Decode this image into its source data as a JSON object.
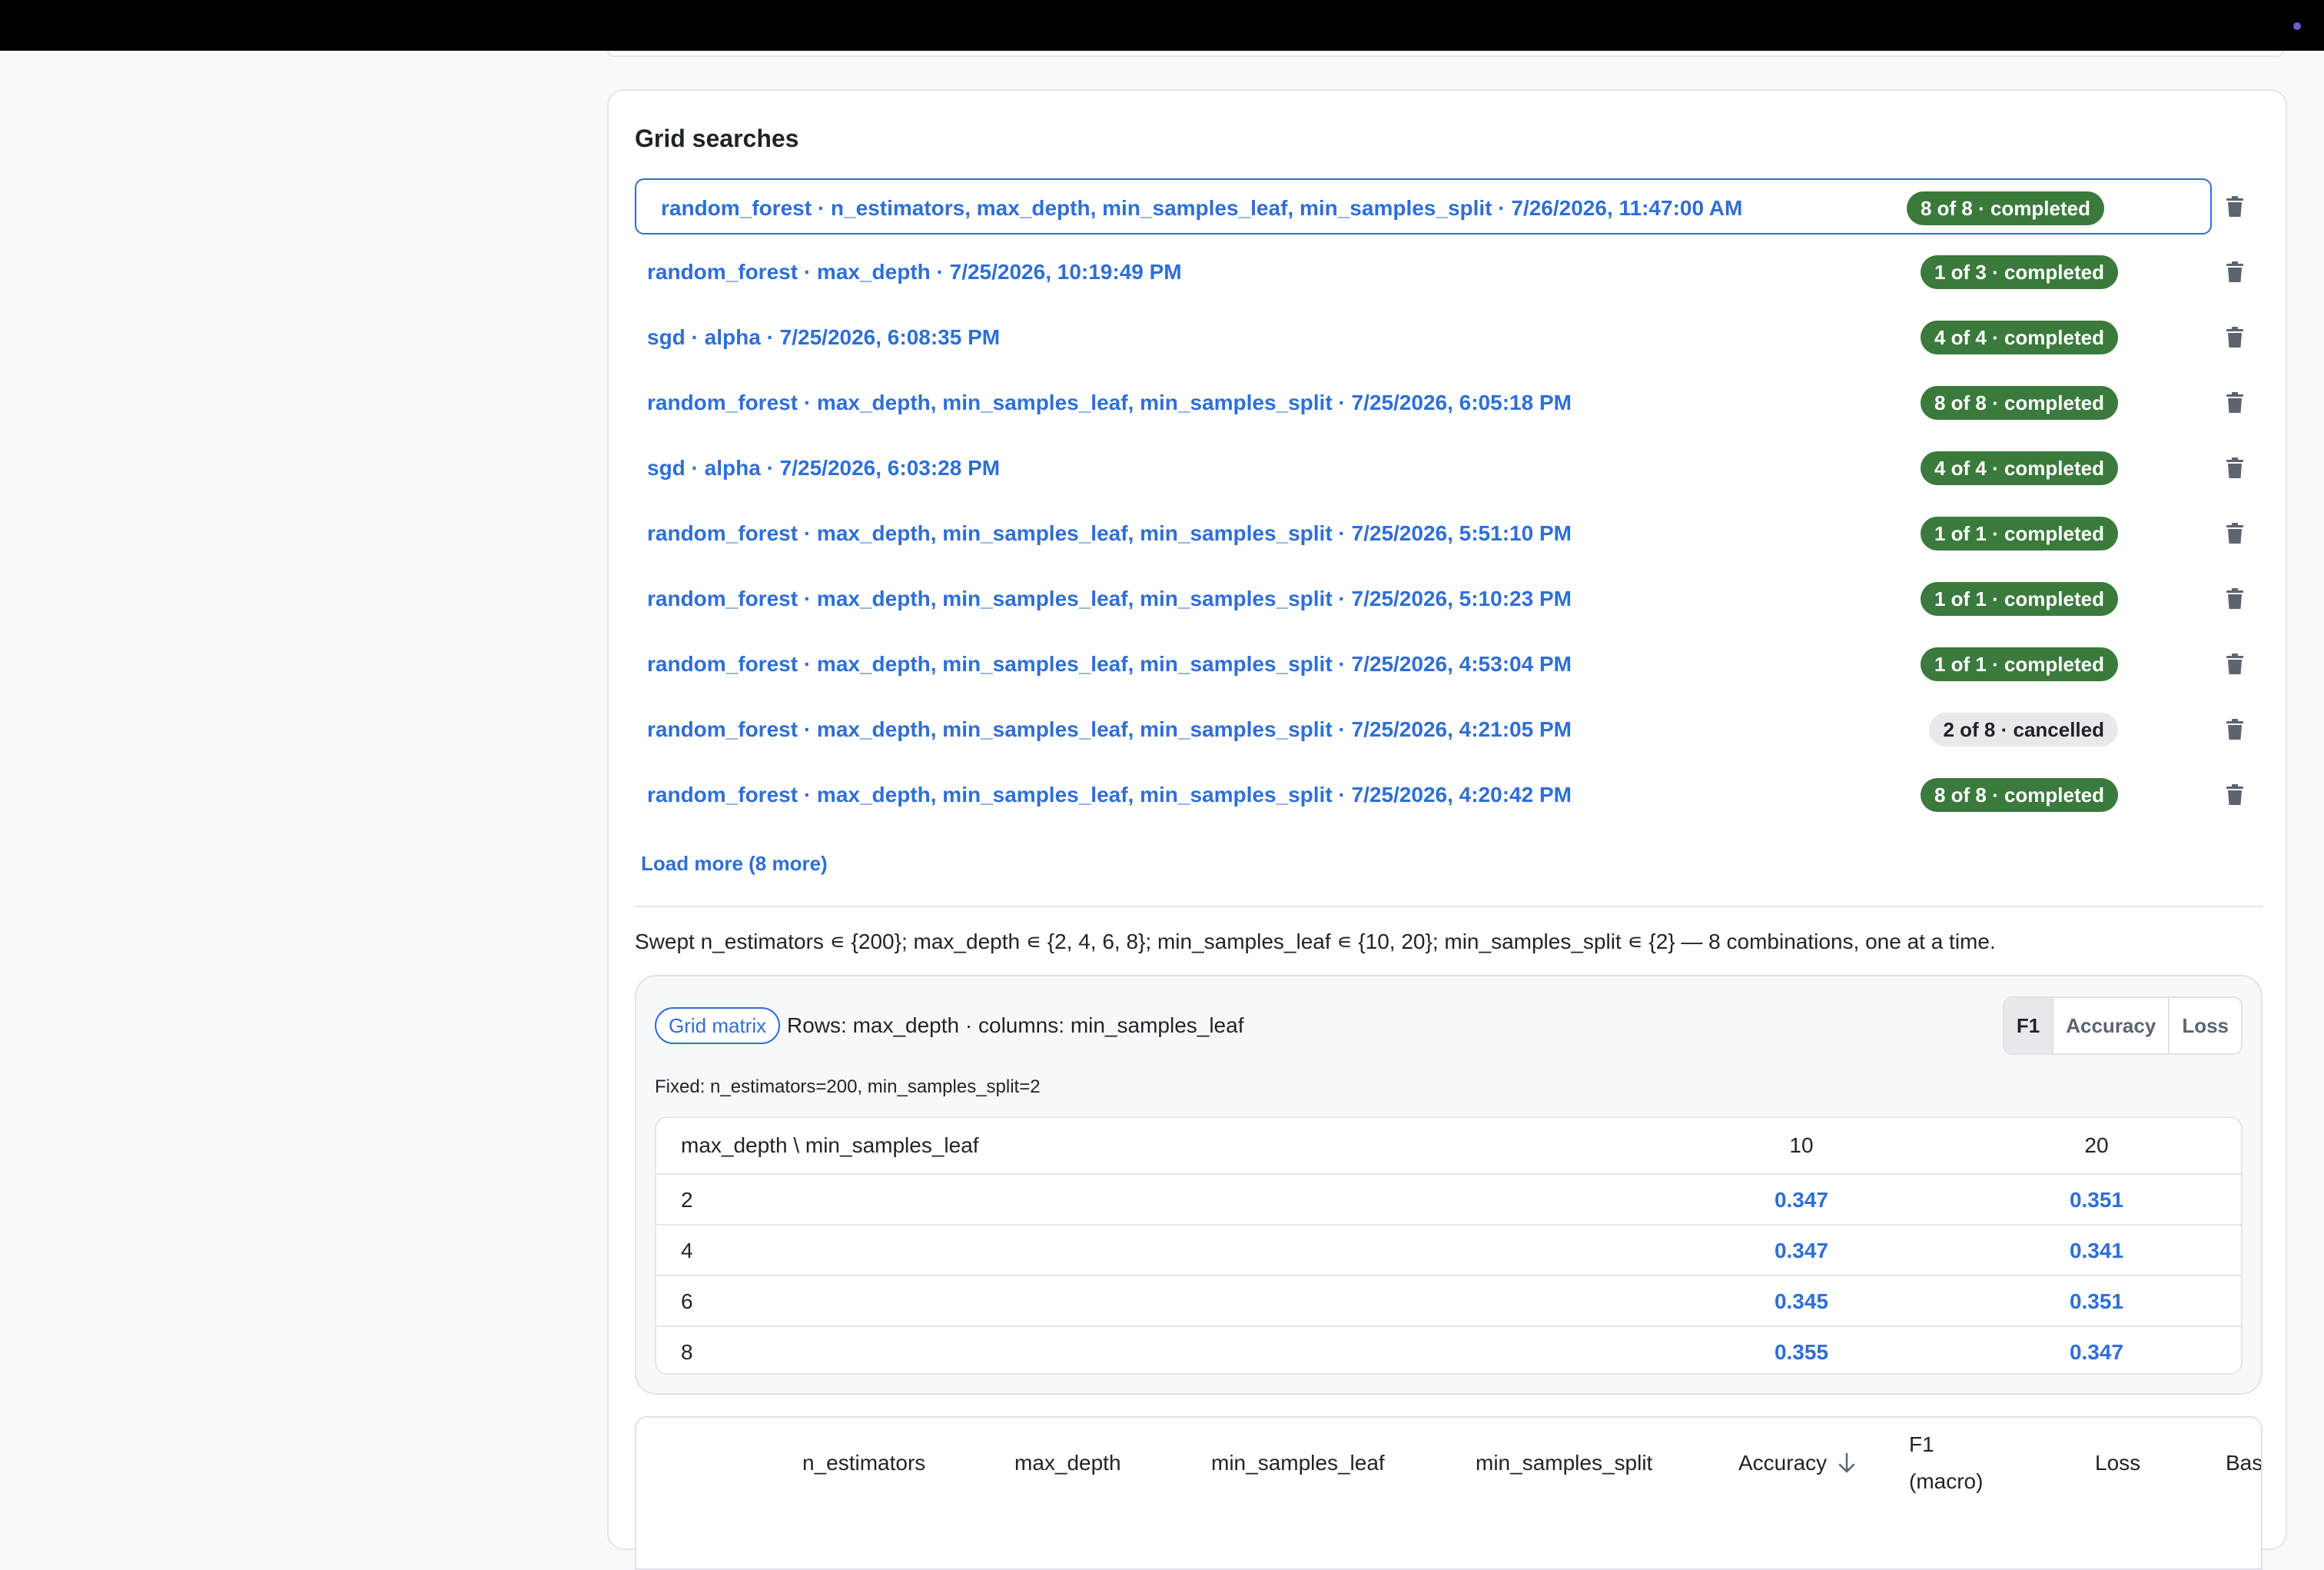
{
  "panel": {
    "title": "Grid searches"
  },
  "grid_searches": [
    {
      "label": "random_forest · n_estimators, max_depth, min_samples_leaf, min_samples_split · 7/26/2026, 11:47:00 AM",
      "status": "8 of 8 · completed",
      "state": "completed",
      "selected": true
    },
    {
      "label": "random_forest · max_depth · 7/25/2026, 10:19:49 PM",
      "status": "1 of 3 · completed",
      "state": "completed"
    },
    {
      "label": "sgd · alpha · 7/25/2026, 6:08:35 PM",
      "status": "4 of 4 · completed",
      "state": "completed"
    },
    {
      "label": "random_forest · max_depth, min_samples_leaf, min_samples_split · 7/25/2026, 6:05:18 PM",
      "status": "8 of 8 · completed",
      "state": "completed"
    },
    {
      "label": "sgd · alpha · 7/25/2026, 6:03:28 PM",
      "status": "4 of 4 · completed",
      "state": "completed"
    },
    {
      "label": "random_forest · max_depth, min_samples_leaf, min_samples_split · 7/25/2026, 5:51:10 PM",
      "status": "1 of 1 · completed",
      "state": "completed"
    },
    {
      "label": "random_forest · max_depth, min_samples_leaf, min_samples_split · 7/25/2026, 5:10:23 PM",
      "status": "1 of 1 · completed",
      "state": "completed"
    },
    {
      "label": "random_forest · max_depth, min_samples_leaf, min_samples_split · 7/25/2026, 4:53:04 PM",
      "status": "1 of 1 · completed",
      "state": "completed"
    },
    {
      "label": "random_forest · max_depth, min_samples_leaf, min_samples_split · 7/25/2026, 4:21:05 PM",
      "status": "2 of 8 · cancelled",
      "state": "cancelled"
    },
    {
      "label": "random_forest · max_depth, min_samples_leaf, min_samples_split · 7/25/2026, 4:20:42 PM",
      "status": "8 of 8 · completed",
      "state": "completed"
    }
  ],
  "load_more": "Load more (8 more)",
  "swept_summary": "Swept n_estimators ∊ {200}; max_depth ∊ {2, 4, 6, 8}; min_samples_leaf ∊ {10, 20}; min_samples_split ∊ {2} — 8 combinations, one at a time.",
  "matrix": {
    "pill": "Grid matrix",
    "subtitle": "Rows: max_depth · columns: min_samples_leaf",
    "metric_tabs": [
      "F1",
      "Accuracy",
      "Loss"
    ],
    "active_metric": "F1",
    "fixed": "Fixed: n_estimators=200, min_samples_split=2",
    "corner_header": "max_depth \\ min_samples_leaf",
    "columns": [
      "10",
      "20"
    ],
    "rows": [
      {
        "label": "2",
        "values": [
          "0.347",
          "0.351"
        ]
      },
      {
        "label": "4",
        "values": [
          "0.347",
          "0.341"
        ]
      },
      {
        "label": "6",
        "values": [
          "0.345",
          "0.351"
        ]
      },
      {
        "label": "8",
        "values": [
          "0.355",
          "0.347"
        ]
      }
    ]
  },
  "results_table": {
    "headers": [
      "n_estimators",
      "max_depth",
      "min_samples_leaf",
      "min_samples_split",
      "Accuracy",
      "F1 (macro)",
      "Loss",
      "Base"
    ],
    "sort_column": "Accuracy",
    "sort_icon": "arrow-down-icon"
  },
  "colors": {
    "accent": "#2f6fd6",
    "completed": "#3a7a3c",
    "cancelled": "#e8e9eb",
    "topbar": "#000000",
    "topbar_dot": "#6b5bd6"
  }
}
